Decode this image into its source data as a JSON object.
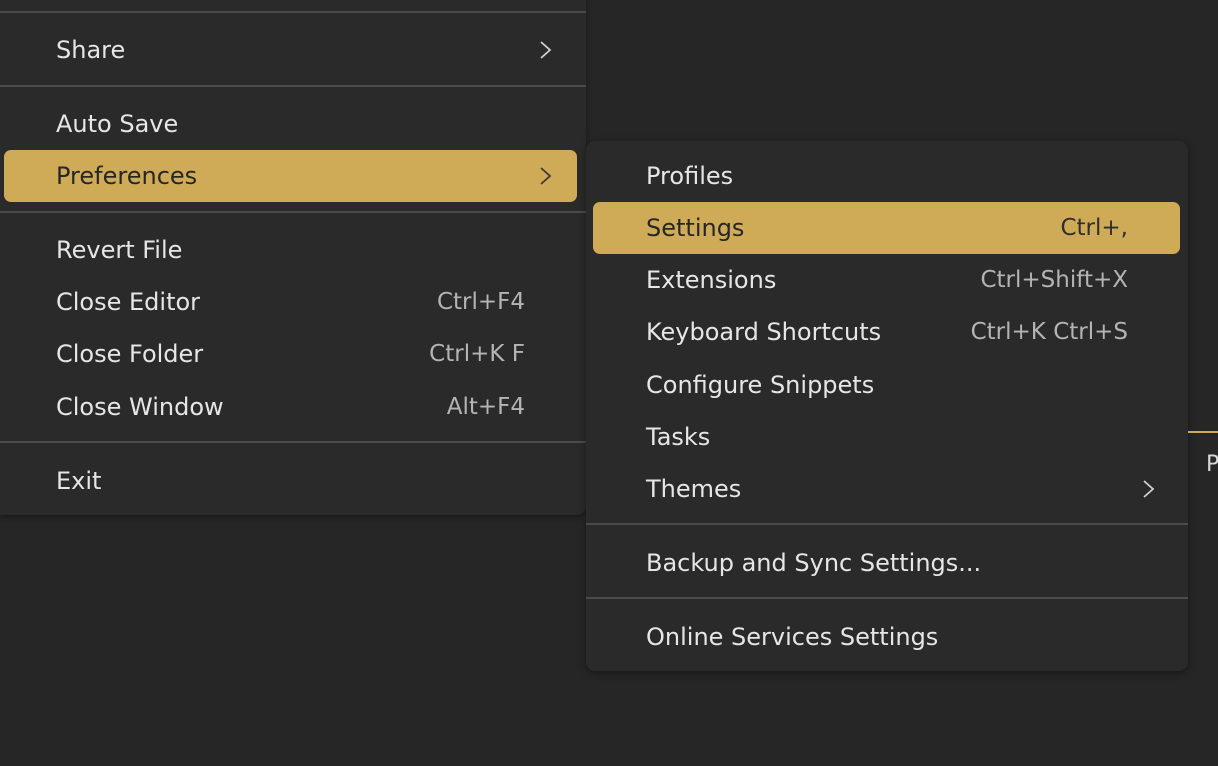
{
  "file_menu": {
    "items": [
      {
        "label": "Share",
        "shortcut": "",
        "submenu": true
      },
      {
        "label": "Auto Save",
        "shortcut": ""
      },
      {
        "label": "Preferences",
        "shortcut": "",
        "submenu": true,
        "highlighted": true
      },
      {
        "label": "Revert File",
        "shortcut": ""
      },
      {
        "label": "Close Editor",
        "shortcut": "Ctrl+F4"
      },
      {
        "label": "Close Folder",
        "shortcut": "Ctrl+K F"
      },
      {
        "label": "Close Window",
        "shortcut": "Alt+F4"
      },
      {
        "label": "Exit",
        "shortcut": ""
      }
    ]
  },
  "preferences_submenu": {
    "items": [
      {
        "label": "Profiles",
        "shortcut": ""
      },
      {
        "label": "Settings",
        "shortcut": "Ctrl+,",
        "highlighted": true
      },
      {
        "label": "Extensions",
        "shortcut": "Ctrl+Shift+X"
      },
      {
        "label": "Keyboard Shortcuts",
        "shortcut": "Ctrl+K Ctrl+S"
      },
      {
        "label": "Configure Snippets",
        "shortcut": ""
      },
      {
        "label": "Tasks",
        "shortcut": ""
      },
      {
        "label": "Themes",
        "shortcut": "",
        "submenu": true
      },
      {
        "label": "Backup and Sync Settings...",
        "shortcut": ""
      },
      {
        "label": "Online Services Settings",
        "shortcut": ""
      }
    ]
  },
  "background_panel": {
    "peek_text": "P"
  },
  "colors": {
    "menu_background": "#2a2a2a",
    "page_background": "#262626",
    "highlight": "#cfab58",
    "separator": "#4b4b4b",
    "text": "#e6e6e6",
    "shortcut_text": "#b4b4b4"
  },
  "icons": {
    "submenu_indicator": "chevron-right-icon"
  }
}
